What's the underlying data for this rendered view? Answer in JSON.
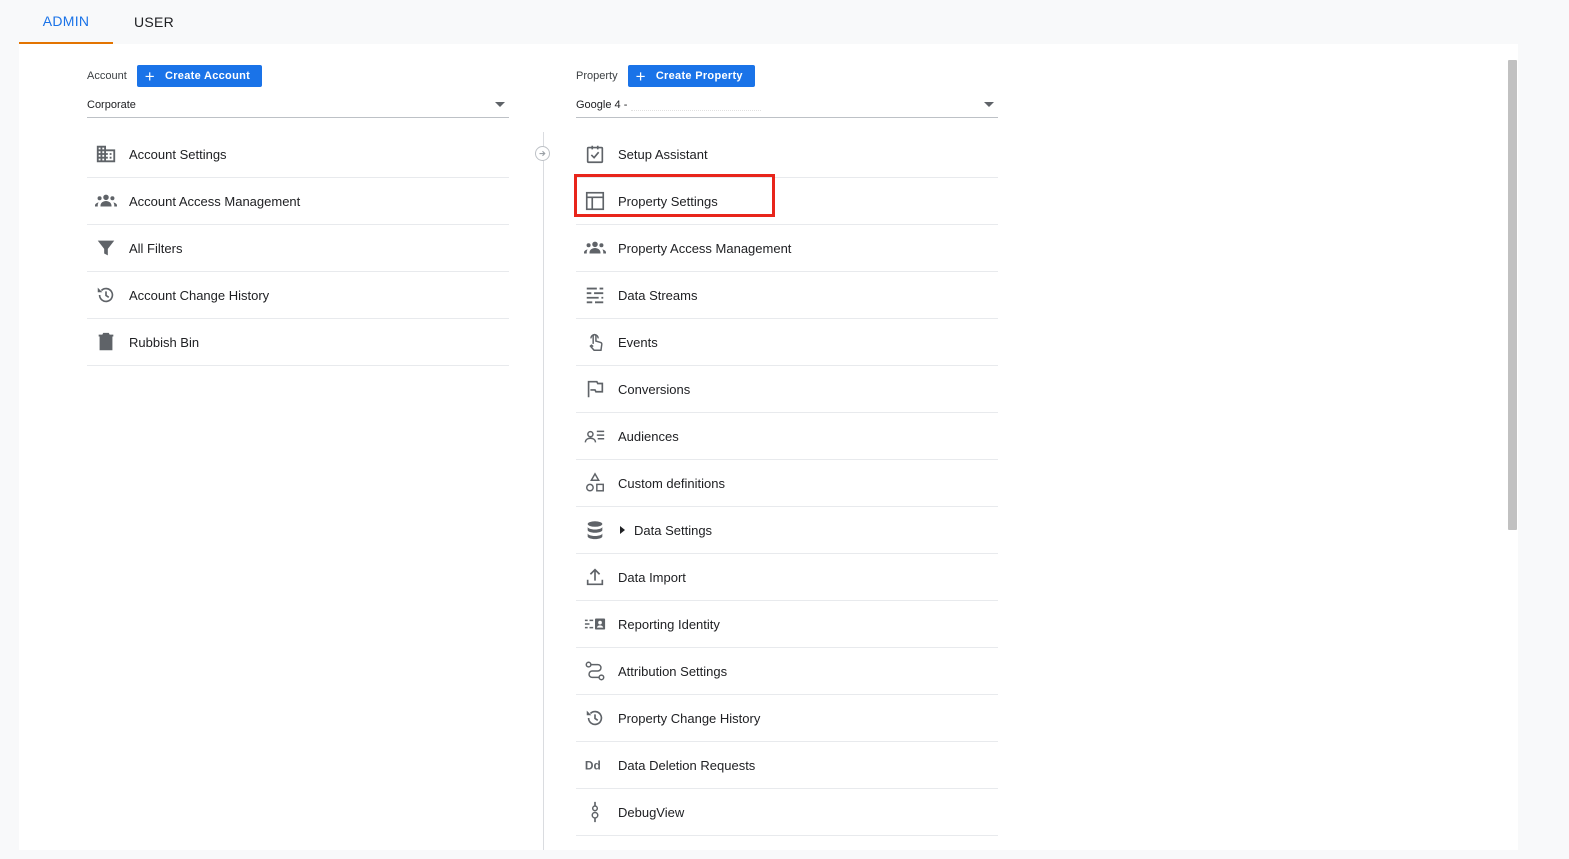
{
  "tabs": {
    "admin": "ADMIN",
    "user": "USER"
  },
  "account": {
    "label": "Account",
    "create_label": "Create Account",
    "selected": "Corporate",
    "items": [
      {
        "label": "Account Settings",
        "icon": "building-icon"
      },
      {
        "label": "Account Access Management",
        "icon": "people-icon"
      },
      {
        "label": "All Filters",
        "icon": "filter-icon"
      },
      {
        "label": "Account Change History",
        "icon": "history-icon"
      },
      {
        "label": "Rubbish Bin",
        "icon": "trash-icon"
      }
    ]
  },
  "property": {
    "label": "Property",
    "create_label": "Create Property",
    "selected": "Google 4 -",
    "items": [
      {
        "label": "Setup Assistant",
        "icon": "checkbox-icon"
      },
      {
        "label": "Property Settings",
        "icon": "layout-icon"
      },
      {
        "label": "Property Access Management",
        "icon": "people-icon"
      },
      {
        "label": "Data Streams",
        "icon": "streams-icon"
      },
      {
        "label": "Events",
        "icon": "touch-icon"
      },
      {
        "label": "Conversions",
        "icon": "flag-icon"
      },
      {
        "label": "Audiences",
        "icon": "audience-icon"
      },
      {
        "label": "Custom definitions",
        "icon": "shapes-icon"
      },
      {
        "label": "Data Settings",
        "icon": "database-icon"
      },
      {
        "label": "Data Import",
        "icon": "upload-icon"
      },
      {
        "label": "Reporting Identity",
        "icon": "identity-icon"
      },
      {
        "label": "Attribution Settings",
        "icon": "attribution-icon"
      },
      {
        "label": "Property Change History",
        "icon": "history-icon"
      },
      {
        "label": "Data Deletion Requests",
        "icon": "dd-icon"
      },
      {
        "label": "DebugView",
        "icon": "debug-icon"
      }
    ]
  }
}
